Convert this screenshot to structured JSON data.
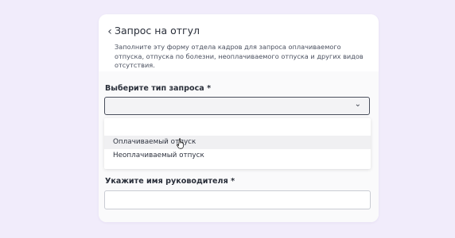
{
  "form": {
    "title": "Запрос на отгул",
    "description": "Заполните эту форму отдела кадров для запроса оплачиваемого отпуска, отпуска по болезни, неоплачиваемого отпуска и других видов отсутствия.",
    "request_type_label": "Выберите тип запроса *",
    "request_type_value": "",
    "request_type_options": [
      "Оплачиваемый отпуск",
      "Неоплачиваемый отпуск"
    ],
    "manager_label": "Укажите имя руководителя *",
    "manager_value": ""
  },
  "icons": {
    "back": "chevron-left-icon",
    "dropdown": "chevron-down-icon",
    "cursor": "hand-pointer-icon"
  },
  "colors": {
    "background": "#f1ecfb",
    "card": "#ffffff",
    "highlight": "#f0f0f2"
  }
}
